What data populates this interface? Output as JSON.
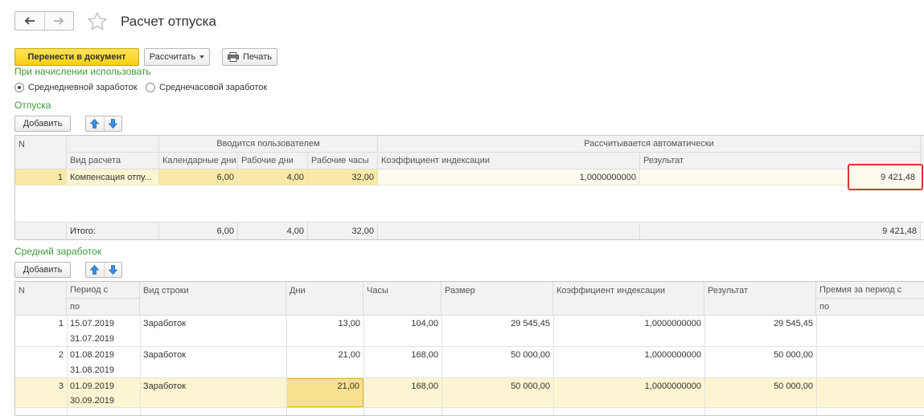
{
  "header": {
    "title": "Расчет отпуска"
  },
  "toolbar": {
    "transfer_label": "Перенести в документ",
    "calc_label": "Рассчитать",
    "print_label": "Печать"
  },
  "accrual": {
    "label": "При начислении использовать",
    "options": [
      {
        "label": "Среднедневной заработок",
        "selected": true
      },
      {
        "label": "Среднечасовой заработок",
        "selected": false
      }
    ]
  },
  "vacations": {
    "section_label": "Отпуска",
    "add_label": "Добавить",
    "group_user": "Вводится пользователем",
    "group_auto": "Рассчитывается автоматически",
    "columns": {
      "n": "N",
      "kind": "Вид расчета",
      "cal_days": "Календарные дни",
      "work_days": "Рабочие дни",
      "work_hours": "Рабочие часы",
      "index_coef": "Коэффициент индексации",
      "result": "Результат"
    },
    "rows": [
      {
        "n": "1",
        "kind": "Компенсация отпу...",
        "cal_days": "6,00",
        "work_days": "4,00",
        "work_hours": "32,00",
        "index_coef": "1,0000000000",
        "result": "9 421,48"
      }
    ],
    "totals": {
      "label": "Итого:",
      "cal_days": "6,00",
      "work_days": "4,00",
      "work_hours": "32,00",
      "result": "9 421,48"
    }
  },
  "earnings": {
    "section_label": "Средний заработок",
    "add_label": "Добавить",
    "columns": {
      "n": "N",
      "period_from": "Период с",
      "period_to": "по",
      "row_kind": "Вид строки",
      "days": "Дни",
      "hours": "Часы",
      "amount": "Размер",
      "index_coef": "Коэффициент индексации",
      "result": "Результат",
      "bonus": "Премия за период с",
      "bonus_to": "по"
    },
    "rows": [
      {
        "n": "1",
        "from": "15.07.2019",
        "to": "31.07.2019",
        "kind": "Заработок",
        "days": "13,00",
        "hours": "104,00",
        "amount": "29 545,45",
        "coef": "1,0000000000",
        "result": "29 545,45"
      },
      {
        "n": "2",
        "from": "01.08.2019",
        "to": "31.08.2019",
        "kind": "Заработок",
        "days": "21,00",
        "hours": "168,00",
        "amount": "50 000,00",
        "coef": "1,0000000000",
        "result": "50 000,00"
      },
      {
        "n": "3",
        "from": "01.09.2019",
        "to": "30.09.2019",
        "kind": "Заработок",
        "days": "21,00",
        "hours": "168,00",
        "amount": "50 000,00",
        "coef": "1,0000000000",
        "result": "50 000,00"
      }
    ]
  },
  "colors": {
    "accent_yellow": "#f6cf12",
    "section_green": "#3c9a3c",
    "highlight_red": "#d9362b",
    "selected_row": "#fdf5d2"
  }
}
